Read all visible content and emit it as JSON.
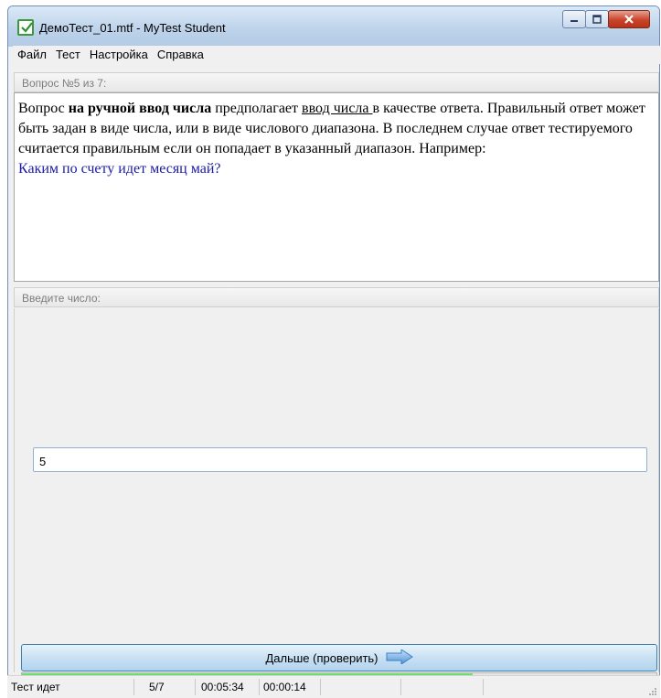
{
  "window": {
    "title": "ДемоТест_01.mtf - MyTest Student",
    "accent": "#3a9a3a"
  },
  "menu": {
    "items": [
      "Файл",
      "Тест",
      "Настройка",
      "Справка"
    ]
  },
  "question": {
    "header": "Вопрос №5 из 7:",
    "text_prefix": "Вопрос ",
    "text_bold": "на ручной ввод числа",
    "text_mid": " предполагает ",
    "text_underline": "ввод числа ",
    "text_rest": "в качестве ответа. Правильный ответ может быть задан в виде числа, или в виде числового диапазона. В последнем случае ответ тестируемого считается правильным если он попадает в указанный диапазон. Например:",
    "example": "Каким по счету идет месяц май?",
    "example_color": "#1a1aa8"
  },
  "answer": {
    "header": "Введите число:",
    "value": "5"
  },
  "actions": {
    "next_label": "Дальше (проверить)"
  },
  "progress": {
    "fraction": 0.71
  },
  "status": {
    "state": "Тест идет",
    "position": "5/7",
    "total_time": "00:05:34",
    "question_time": "00:00:14"
  }
}
